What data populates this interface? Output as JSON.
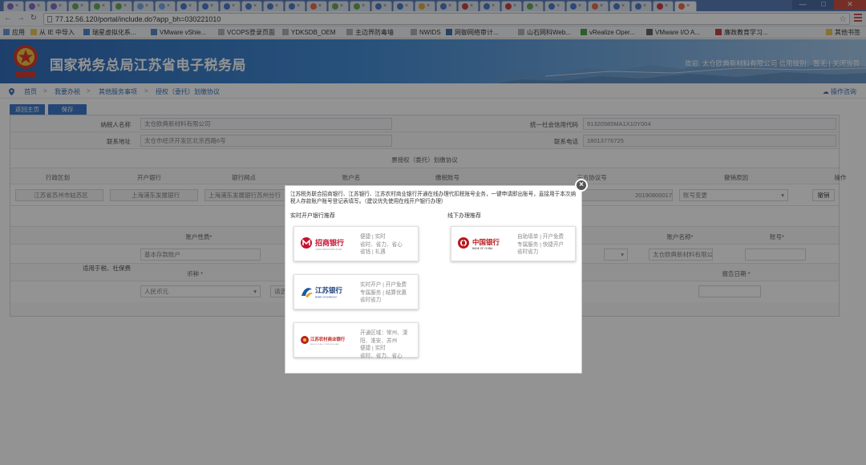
{
  "browser": {
    "url": "77.12.56.120/portal/include.do?app_bh=030221010",
    "bookmarks": [
      {
        "label": "应用",
        "color": "#5a8fd6"
      },
      {
        "label": "从 IE 中导入",
        "color": "#e8c04a"
      },
      {
        "label": "瑞星虚拟化系...",
        "color": "#3b7ed0"
      },
      {
        "label": "VMware vShie...",
        "color": "#4a7dc4"
      },
      {
        "label": "VCOPS登录页面",
        "color": "#aaaaaa"
      },
      {
        "label": "YDKSDB_OEM",
        "color": "#aaaaaa"
      },
      {
        "label": "主边界防毒墙",
        "color": "#aaaaaa"
      },
      {
        "label": "NWIDS",
        "color": "#aaaaaa"
      },
      {
        "label": "网御网络审计...",
        "color": "#3060a8"
      },
      {
        "label": "山石网科Web...",
        "color": "#aaaaaa"
      },
      {
        "label": "vRealize Oper...",
        "color": "#3a9a3a"
      },
      {
        "label": "VMware I/O A...",
        "color": "#555555"
      },
      {
        "label": "廉政教育学习...",
        "color": "#c03030"
      },
      {
        "label": "其他书签",
        "color": "#e8c04a"
      }
    ]
  },
  "header": {
    "site_title": "国家税务总局江苏省电子税务局",
    "welcome": "欢迎, 太仓欧典新材料有限公司  信用级别：暂无  |  关闭当页"
  },
  "breadcrumb": {
    "items": [
      "首页",
      "我要办税",
      "其他服务事项",
      "授权（委托）划缴协议"
    ],
    "help": "操作咨询"
  },
  "actions": {
    "back": "返回主页",
    "save": "保存"
  },
  "form": {
    "taxpayer_name_label": "纳税人名称",
    "taxpayer_name": "太仓欧典新材料有限公司",
    "credit_code_label": "统一社会信用代码",
    "credit_code": "91320585MA1X10Y004",
    "address_label": "联系地址",
    "address": "太仓市经济开发区北京西路6号",
    "phone_label": "联系电话",
    "phone": "18013776725",
    "agreement_title": "票授权（委托）划缴协议",
    "columns": [
      "行政区划",
      "开户银行",
      "银行网点",
      "账户名",
      "缴税账号",
      "三方协议号",
      "撤销原因",
      "操作"
    ],
    "row": {
      "region": "江苏省苏州市姑苏区",
      "bank": "上海浦东发展银行",
      "branch": "上海浦东发展银行苏州分行",
      "protocol_no": "20190800017",
      "reason": "账号变更",
      "action": "撤销"
    },
    "account_nature_label": "账户性质*",
    "account_nature": "基本存款账户",
    "account_name_label": "账户名称*",
    "account_name": "太仓欧典新材料有限公司",
    "account_no_label": "账号*",
    "applies_label": "适用于税、社保费",
    "currency_label": "币种 *",
    "currency": "人民币元",
    "currency2": "请选",
    "report_date_label": "报告日期 *"
  },
  "modal": {
    "notice": "江苏税务联合招商银行、江苏银行、江苏农村商业银行开通在线办理代扣税账号业务，一键申请即出账号，直接用于本次纳税人存款账户账号登记表填写。（建议优先使用在线开户银行办理）",
    "online_title": "实时开户银行推荐",
    "offline_title": "线下办理推荐",
    "cards": [
      {
        "name": "招商银行",
        "sub": "CHINA MERCHANTS BANK",
        "desc": "便捷 | 实时\n省时、省力、省心\n省钱 | 礼遇",
        "color": "#c8102e"
      },
      {
        "name": "江苏银行",
        "sub": "BANK OF JIANGSU",
        "desc": "实时开户 | 开户免费\n专属服务 | 结算优惠\n省时省力",
        "color": "#1a5aa8"
      },
      {
        "name": "江苏农村商业银行",
        "sub": "JIANGSU RURAL COMMERCIAL BANK",
        "desc": "开通区域：常州、溧阳、淮安、苏州\n便捷 | 实时\n省时、省力、省心",
        "color": "#b8231f"
      },
      {
        "name": "中国银行",
        "sub": "BANK OF CHINA",
        "desc": "自助填单 | 开户免费\n专属服务 | 快捷开户\n省时省力",
        "color": "#b8181c"
      }
    ]
  }
}
